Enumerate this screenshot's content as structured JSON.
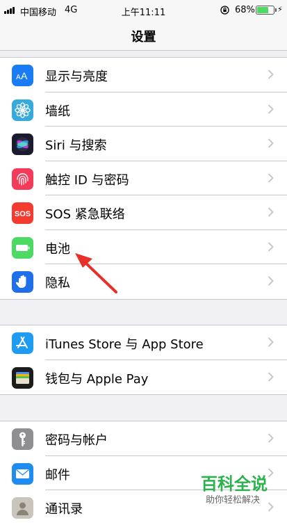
{
  "status_bar": {
    "carrier": "中国移动",
    "network": "4G",
    "time": "上午11:11",
    "battery_percent": "68%",
    "battery_level": 0.68
  },
  "nav": {
    "title": "设置"
  },
  "groups": [
    {
      "items": [
        {
          "label": "显示与亮度",
          "icon": "display-brightness-icon",
          "color": "#1a7cf5"
        },
        {
          "label": "墙纸",
          "icon": "wallpaper-flower-icon",
          "color": "#36aadc"
        },
        {
          "label": "Siri 与搜索",
          "icon": "siri-icon",
          "color": "#1b1b2e"
        },
        {
          "label": "触控 ID 与密码",
          "icon": "fingerprint-icon",
          "color": "#f53b5a"
        },
        {
          "label": "SOS 紧急联络",
          "icon": "sos-icon",
          "color": "#f33b30"
        },
        {
          "label": "电池",
          "icon": "battery-icon",
          "color": "#4cd964"
        },
        {
          "label": "隐私",
          "icon": "privacy-hand-icon",
          "color": "#1f6fea"
        }
      ]
    },
    {
      "items": [
        {
          "label": "iTunes Store 与 App Store",
          "icon": "app-store-icon",
          "color": "#1e9bf3"
        },
        {
          "label": "钱包与 Apple Pay",
          "icon": "wallet-icon",
          "color": "#1c1c1c"
        }
      ]
    },
    {
      "items": [
        {
          "label": "密码与帐户",
          "icon": "key-icon",
          "color": "#8e8e93"
        },
        {
          "label": "邮件",
          "icon": "mail-icon",
          "color": "#1e8cf0"
        },
        {
          "label": "通讯录",
          "icon": "contacts-icon",
          "color": "#c9c5bd"
        }
      ]
    }
  ],
  "annotation": {
    "arrow_target": "电池"
  },
  "watermark": {
    "title": "百科全说",
    "subtitle": "助你轻松解决"
  }
}
